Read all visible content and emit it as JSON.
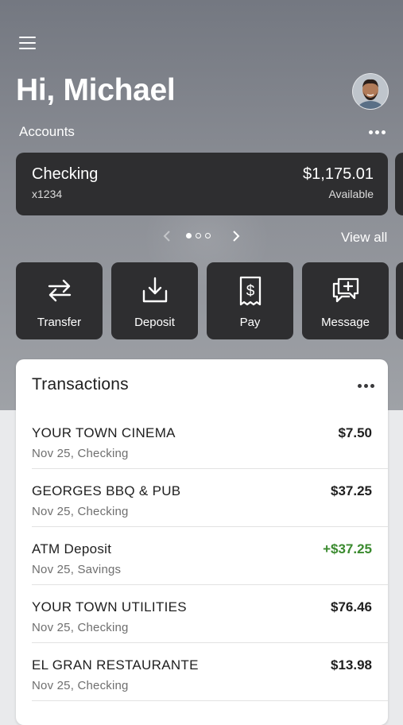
{
  "header": {
    "greeting": "Hi, Michael",
    "menu_icon": "hamburger-menu-icon",
    "avatar": "user-avatar-photo"
  },
  "accounts": {
    "label": "Accounts",
    "more_icon": "more-dots-icon",
    "cards": [
      {
        "name": "Checking",
        "number": "x1234",
        "balance": "$1,175.01",
        "balance_label": "Available"
      }
    ],
    "pager": {
      "pages": 3,
      "current": 1
    },
    "view_all": "View all"
  },
  "actions": [
    {
      "label": "Transfer",
      "icon": "transfer-arrows-icon"
    },
    {
      "label": "Deposit",
      "icon": "deposit-download-icon"
    },
    {
      "label": "Pay",
      "icon": "pay-receipt-dollar-icon"
    },
    {
      "label": "Message",
      "icon": "message-plus-icon"
    }
  ],
  "transactions": {
    "title": "Transactions",
    "items": [
      {
        "name": "YOUR TOWN CINEMA",
        "detail": "Nov 25, Checking",
        "amount": "$7.50",
        "credit": false
      },
      {
        "name": "GEORGES BBQ & PUB",
        "detail": "Nov 25, Checking",
        "amount": "$37.25",
        "credit": false
      },
      {
        "name": "ATM Deposit",
        "detail": "Nov 25, Savings",
        "amount": "+$37.25",
        "credit": true
      },
      {
        "name": "YOUR TOWN UTILITIES",
        "detail": "Nov 25, Checking",
        "amount": "$76.46",
        "credit": false
      },
      {
        "name": "EL GRAN RESTAURANTE",
        "detail": "Nov 25, Checking",
        "amount": "$13.98",
        "credit": false
      }
    ]
  },
  "colors": {
    "card_dark": "#2e2e30",
    "credit_green": "#3a8a2e",
    "hero_gray": "#7f838a"
  }
}
